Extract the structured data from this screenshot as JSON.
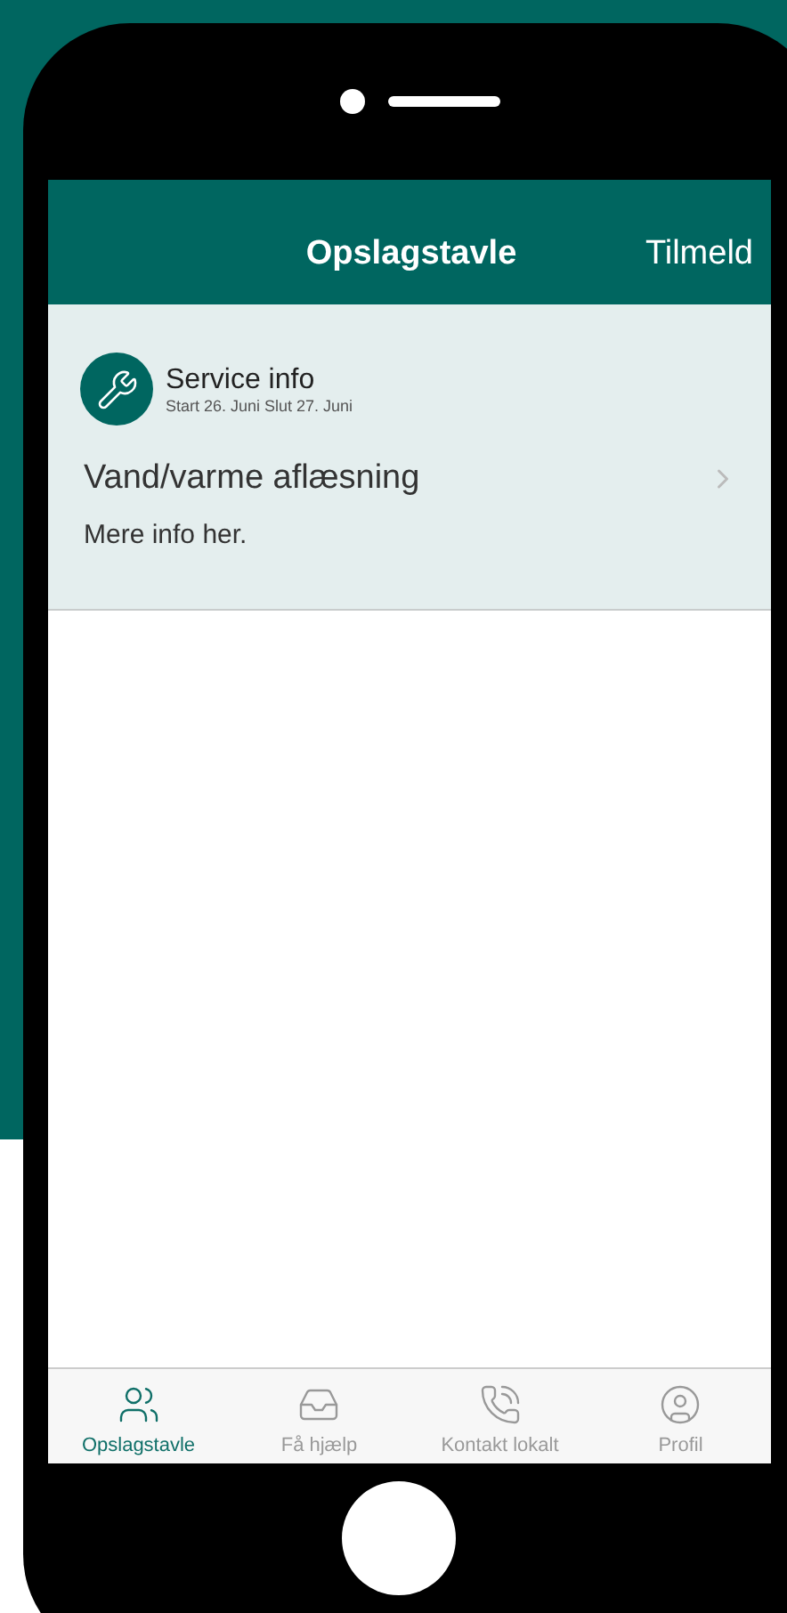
{
  "header": {
    "title": "Opslagstavle",
    "action": "Tilmeld"
  },
  "posts": [
    {
      "category": "Service info",
      "dates": "Start 26. Juni Slut 27. Juni",
      "title": "Vand/varme aflæsning",
      "body": "Mere info her."
    }
  ],
  "tabs": [
    {
      "label": "Opslagstavle",
      "selected": true
    },
    {
      "label": "Få hjælp",
      "selected": false
    },
    {
      "label": "Kontakt lokalt",
      "selected": false
    },
    {
      "label": "Profil",
      "selected": false
    }
  ]
}
